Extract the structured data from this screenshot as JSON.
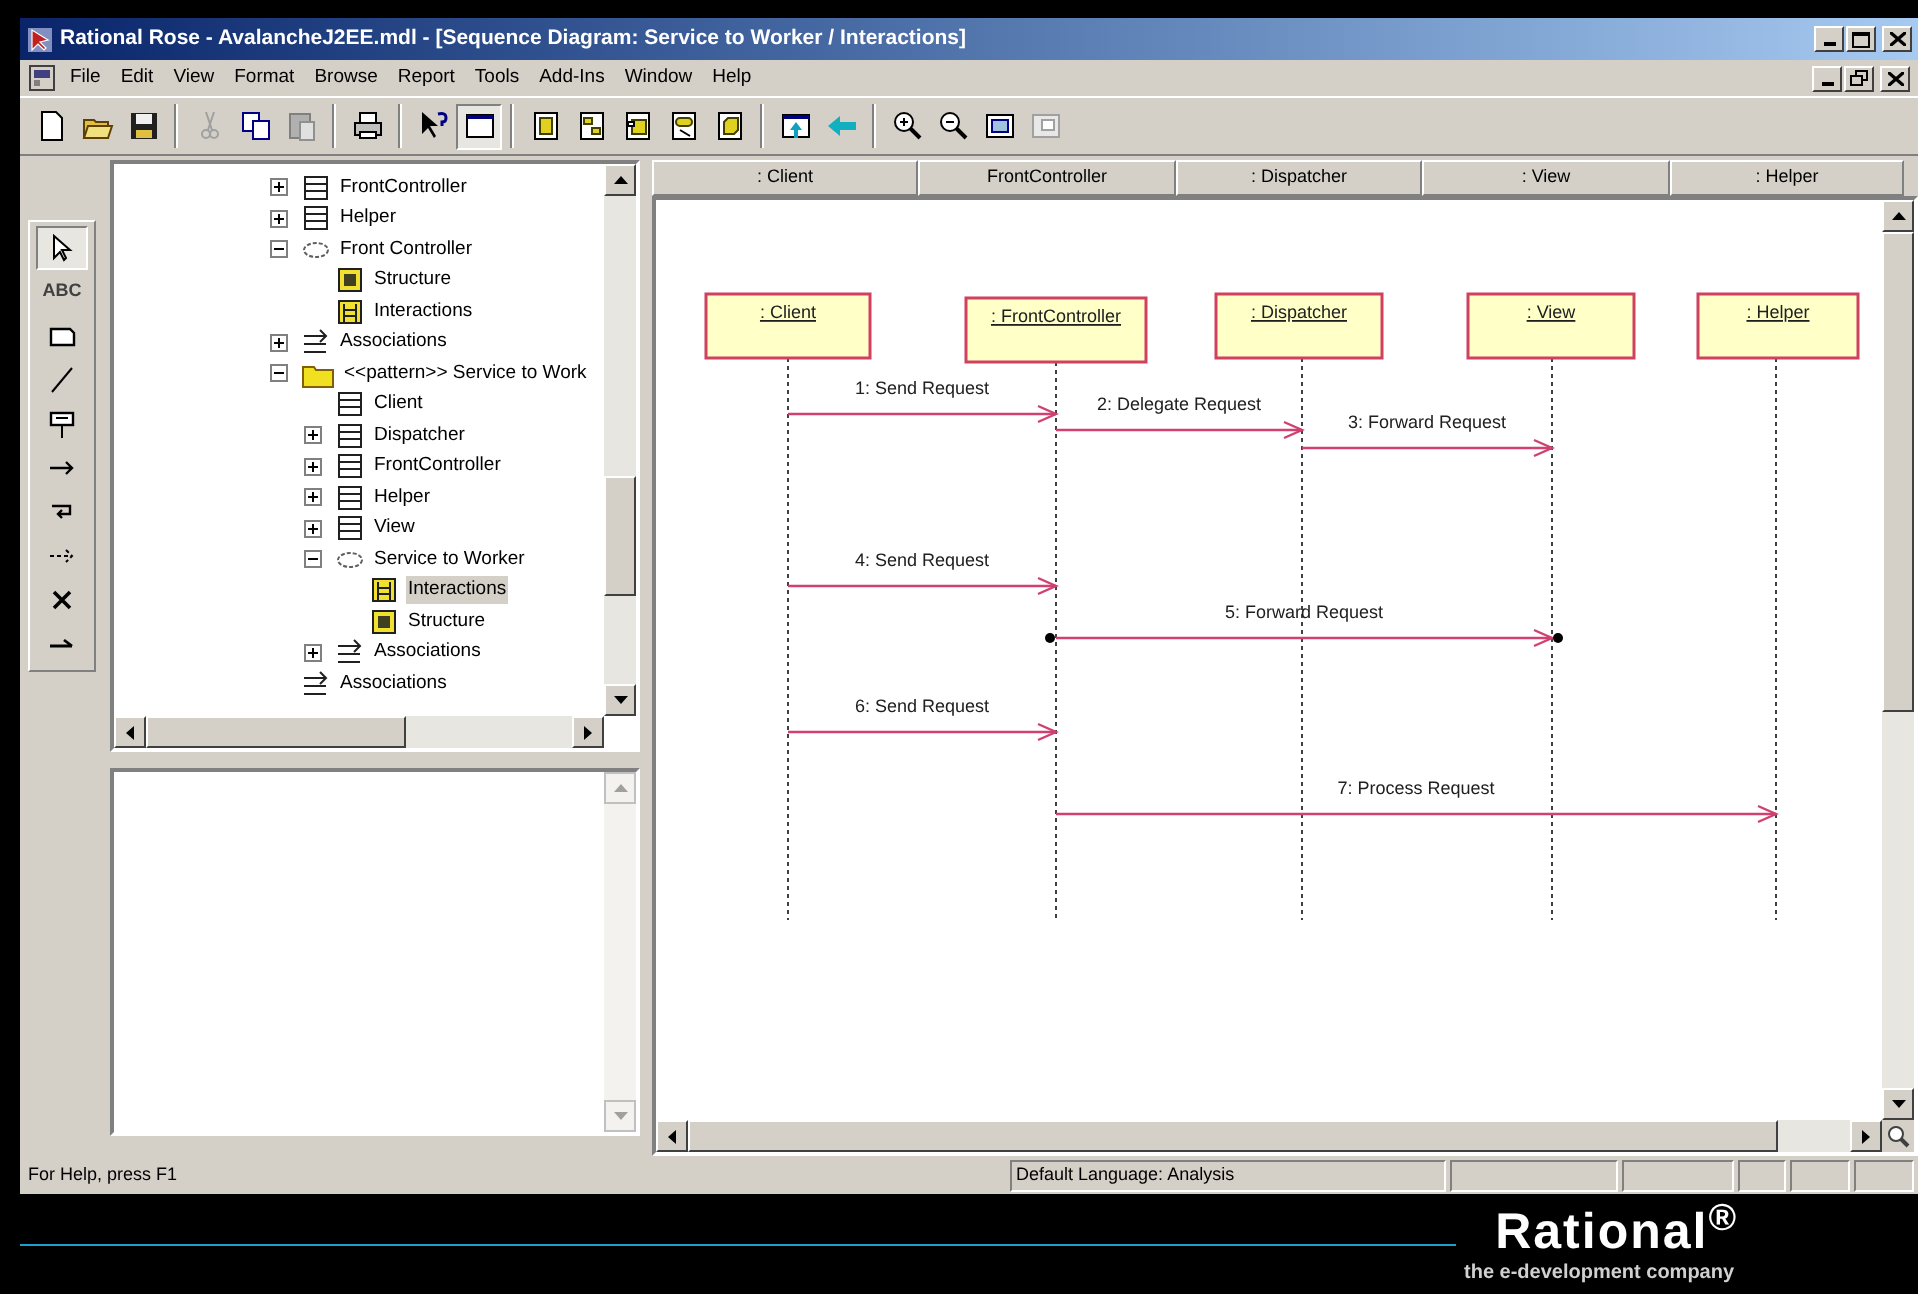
{
  "window": {
    "title": "Rational Rose - AvalancheJ2EE.mdl - [Sequence Diagram: Service to Worker / Interactions]"
  },
  "menu": [
    "File",
    "Edit",
    "View",
    "Format",
    "Browse",
    "Report",
    "Tools",
    "Add-Ins",
    "Window",
    "Help"
  ],
  "palette": {
    "text_tool": "ABC"
  },
  "browser": {
    "tree": [
      {
        "label": "FrontController",
        "kind": "class",
        "expanded": false
      },
      {
        "label": "Helper",
        "kind": "class",
        "expanded": false
      },
      {
        "label": "Front Controller",
        "kind": "collaboration",
        "expanded": true,
        "children": [
          {
            "label": "Structure",
            "kind": "structure",
            "selected": false
          },
          {
            "label": "Interactions",
            "kind": "interactions",
            "selected": false
          }
        ]
      },
      {
        "label": "Associations",
        "kind": "associations",
        "expanded": false
      },
      {
        "label": "<<pattern>> Service to Work",
        "kind": "package",
        "expanded": true,
        "children": [
          {
            "label": "Client",
            "kind": "class"
          },
          {
            "label": "Dispatcher",
            "kind": "class",
            "expanded": false
          },
          {
            "label": "FrontController",
            "kind": "class",
            "expanded": false
          },
          {
            "label": "Helper",
            "kind": "class",
            "expanded": false
          },
          {
            "label": "View",
            "kind": "class",
            "expanded": false
          },
          {
            "label": "Service to Worker",
            "kind": "collaboration",
            "expanded": true,
            "children": [
              {
                "label": "Interactions",
                "kind": "interactions",
                "selected": true
              },
              {
                "label": "Structure",
                "kind": "structure",
                "selected": false
              }
            ]
          },
          {
            "label": "Associations",
            "kind": "associations",
            "expanded": false
          }
        ]
      },
      {
        "label": "Associations",
        "kind": "associations"
      }
    ]
  },
  "diagram": {
    "header": [
      ": Client",
      "FrontController",
      ": Dispatcher",
      ": View",
      ": Helper"
    ],
    "objects": [
      ": Client",
      ": FrontController",
      ": Dispatcher",
      ": View",
      ": Helper"
    ],
    "messages": [
      {
        "label": "1: Send Request",
        "focus_dots": false
      },
      {
        "label": "2: Delegate Request",
        "focus_dots": false
      },
      {
        "label": "3: Forward Request",
        "focus_dots": false
      },
      {
        "label": "4: Send Request",
        "focus_dots": false
      },
      {
        "label": "5: Forward Request",
        "focus_dots": true
      },
      {
        "label": "6: Send Request",
        "focus_dots": false
      },
      {
        "label": "7: Process Request",
        "focus_dots": false
      }
    ]
  },
  "status_bar": {
    "help": "For Help, press F1",
    "language": "Default Language: Analysis"
  },
  "branding": {
    "logo": "Rational$^{®}$",
    "tagline": "the **e-development** company"
  }
}
